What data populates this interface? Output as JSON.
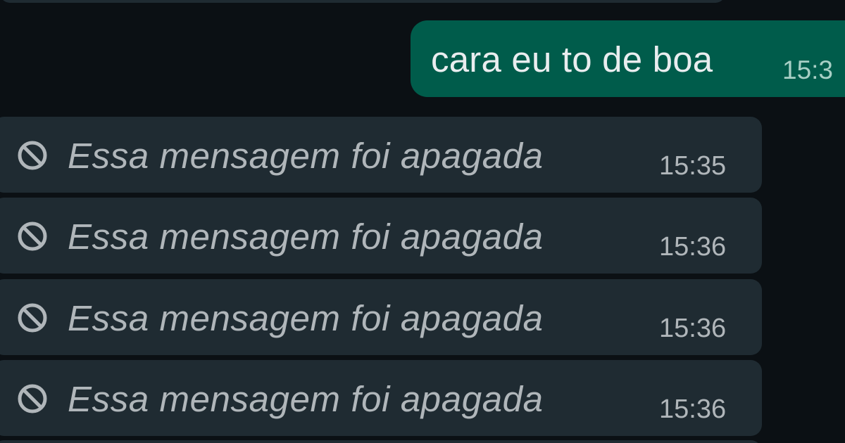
{
  "colors": {
    "background": "#0b1014",
    "outgoing_bubble": "#005c4b",
    "incoming_bubble": "#1f2b32",
    "deleted_text": "#b0b6ba"
  },
  "messages": [
    {
      "direction": "outgoing",
      "text": "cara eu to de boa",
      "time": "15:3"
    },
    {
      "direction": "incoming",
      "deleted": true,
      "icon": "deleted-icon",
      "text": "Essa mensagem foi apagada",
      "time": "15:35"
    },
    {
      "direction": "incoming",
      "deleted": true,
      "icon": "deleted-icon",
      "text": "Essa mensagem foi apagada",
      "time": "15:36"
    },
    {
      "direction": "incoming",
      "deleted": true,
      "icon": "deleted-icon",
      "text": "Essa mensagem foi apagada",
      "time": "15:36"
    },
    {
      "direction": "incoming",
      "deleted": true,
      "icon": "deleted-icon",
      "text": "Essa mensagem foi apagada",
      "time": "15:36"
    }
  ]
}
